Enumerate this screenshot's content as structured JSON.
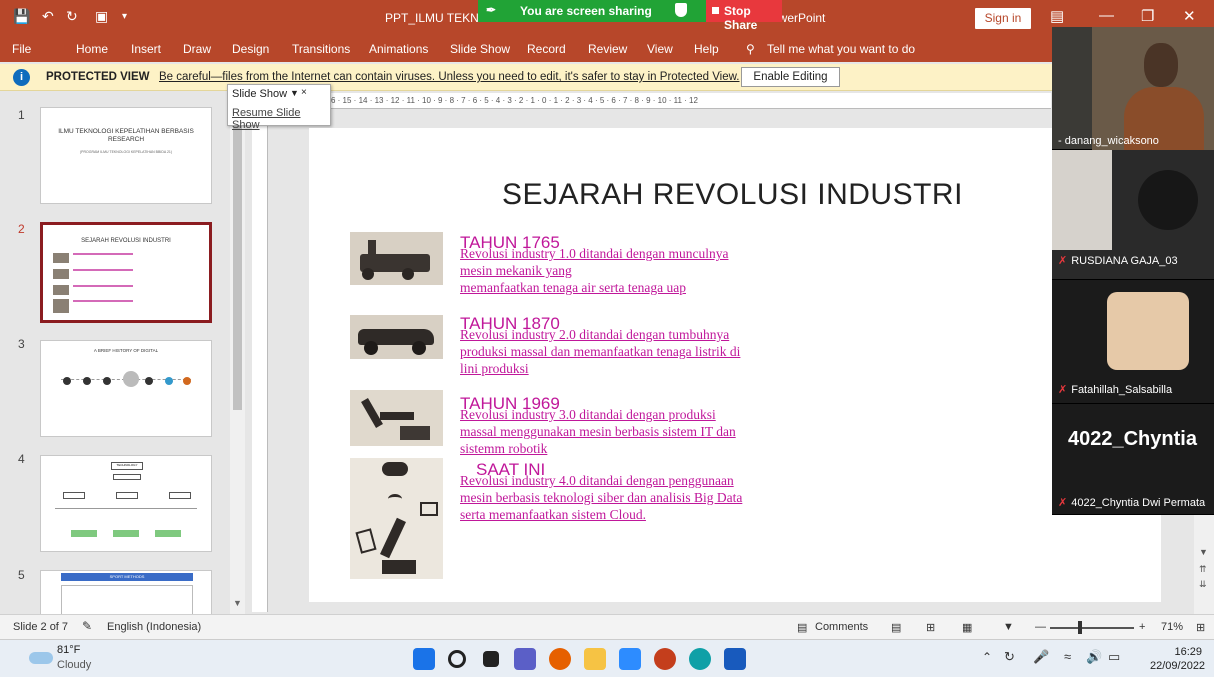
{
  "titlebar": {
    "doc_title_left": "PPT_ILMU TEKNOL",
    "doc_title_right": "owerPoint",
    "sign_in": "Sign in"
  },
  "share": {
    "banner": "You are screen sharing",
    "stop": "Stop Share"
  },
  "ribbon": {
    "tabs": [
      "File",
      "Home",
      "Insert",
      "Draw",
      "Design",
      "Transitions",
      "Animations",
      "Slide Show",
      "Record",
      "Review",
      "View",
      "Help"
    ],
    "tell_me": "Tell me what you want to do"
  },
  "protected": {
    "label": "PROTECTED VIEW",
    "message": "Be careful—files from the Internet can contain viruses. Unless you need to edit, it's safer to stay in Protected View.",
    "enable_button": "Enable Editing"
  },
  "popup": {
    "title": "Slide Show",
    "resume": "Resume Slide Show"
  },
  "ruler": {
    "horizontal": "6 · 15 · 14 · 13 · 12 · 11 · 10 · 9 · 8 · 7 · 6 · 5 · 4 · 3 · 2 · 1 · 0 · 1 · 2 · 3 · 4 · 5 · 6 · 7 · 8 · 9 · 10 · 11 · 12"
  },
  "thumbnails": [
    {
      "num": "1",
      "title": "ILMU TEKNOLOGI KEPELATIHAN BERBASIS RESEARCH",
      "sub": "(PROGRAM ILMU TEKNOLOGI KEPELATIHAN BBIDA 21)"
    },
    {
      "num": "2",
      "title": "SEJARAH REVOLUSI INDUSTRI"
    },
    {
      "num": "3",
      "title": "A BRIEF HISTORY OF DIGITAL"
    },
    {
      "num": "4",
      "title": "TECHNOLOGY"
    },
    {
      "num": "5",
      "title": "SPORT METHODS"
    }
  ],
  "slide": {
    "title": "SEJARAH REVOLUSI INDUSTRI",
    "sections": [
      {
        "year": "TAHUN 1765",
        "lines": [
          "Revolusi industry 1.0 ditandai dengan munculnya",
          "mesin mekanik yang",
          "memanfaatkan tenaga air serta tenaga uap"
        ]
      },
      {
        "year": "TAHUN 1870",
        "lines": [
          "Revolusi industry 2.0 ditandai dengan tumbuhnya",
          "produksi massal dan memanfaatkan tenaga listrik di",
          "lini produksi"
        ]
      },
      {
        "year": "TAHUN 1969",
        "lines": [
          "Revolusi industry 3.0 ditandai dengan produksi",
          "massal menggunakan mesin berbasis sistem IT dan",
          "sistemm robotik"
        ]
      },
      {
        "year": "SAAT INI",
        "lines": [
          "Revolusi industry 4.0 ditandai dengan penggunaan",
          "mesin berbasis teknologi siber dan analisis Big Data",
          "serta memanfaatkan sistem Cloud."
        ]
      }
    ]
  },
  "participants": [
    {
      "name": "danang_wicaksono",
      "muted": false
    },
    {
      "name": "RUSDIANA GAJA_03",
      "muted": true
    },
    {
      "name": "Fatahillah_Salsabilla",
      "muted": true
    },
    {
      "name": "4022_Chyntia Dwi Permata",
      "muted": true,
      "display": "4022_Chyntia"
    }
  ],
  "status": {
    "slide_count": "Slide 2 of 7",
    "language": "English (Indonesia)",
    "comments": "Comments",
    "zoom": "71%"
  },
  "taskbar": {
    "temp": "81°F",
    "condition": "Cloudy",
    "time": "16:29",
    "date": "22/09/2022"
  },
  "colors": {
    "accent": "#b7472a",
    "slide_text": "#c0179a",
    "share_green": "#21a336",
    "stop_red": "#e8383d"
  }
}
